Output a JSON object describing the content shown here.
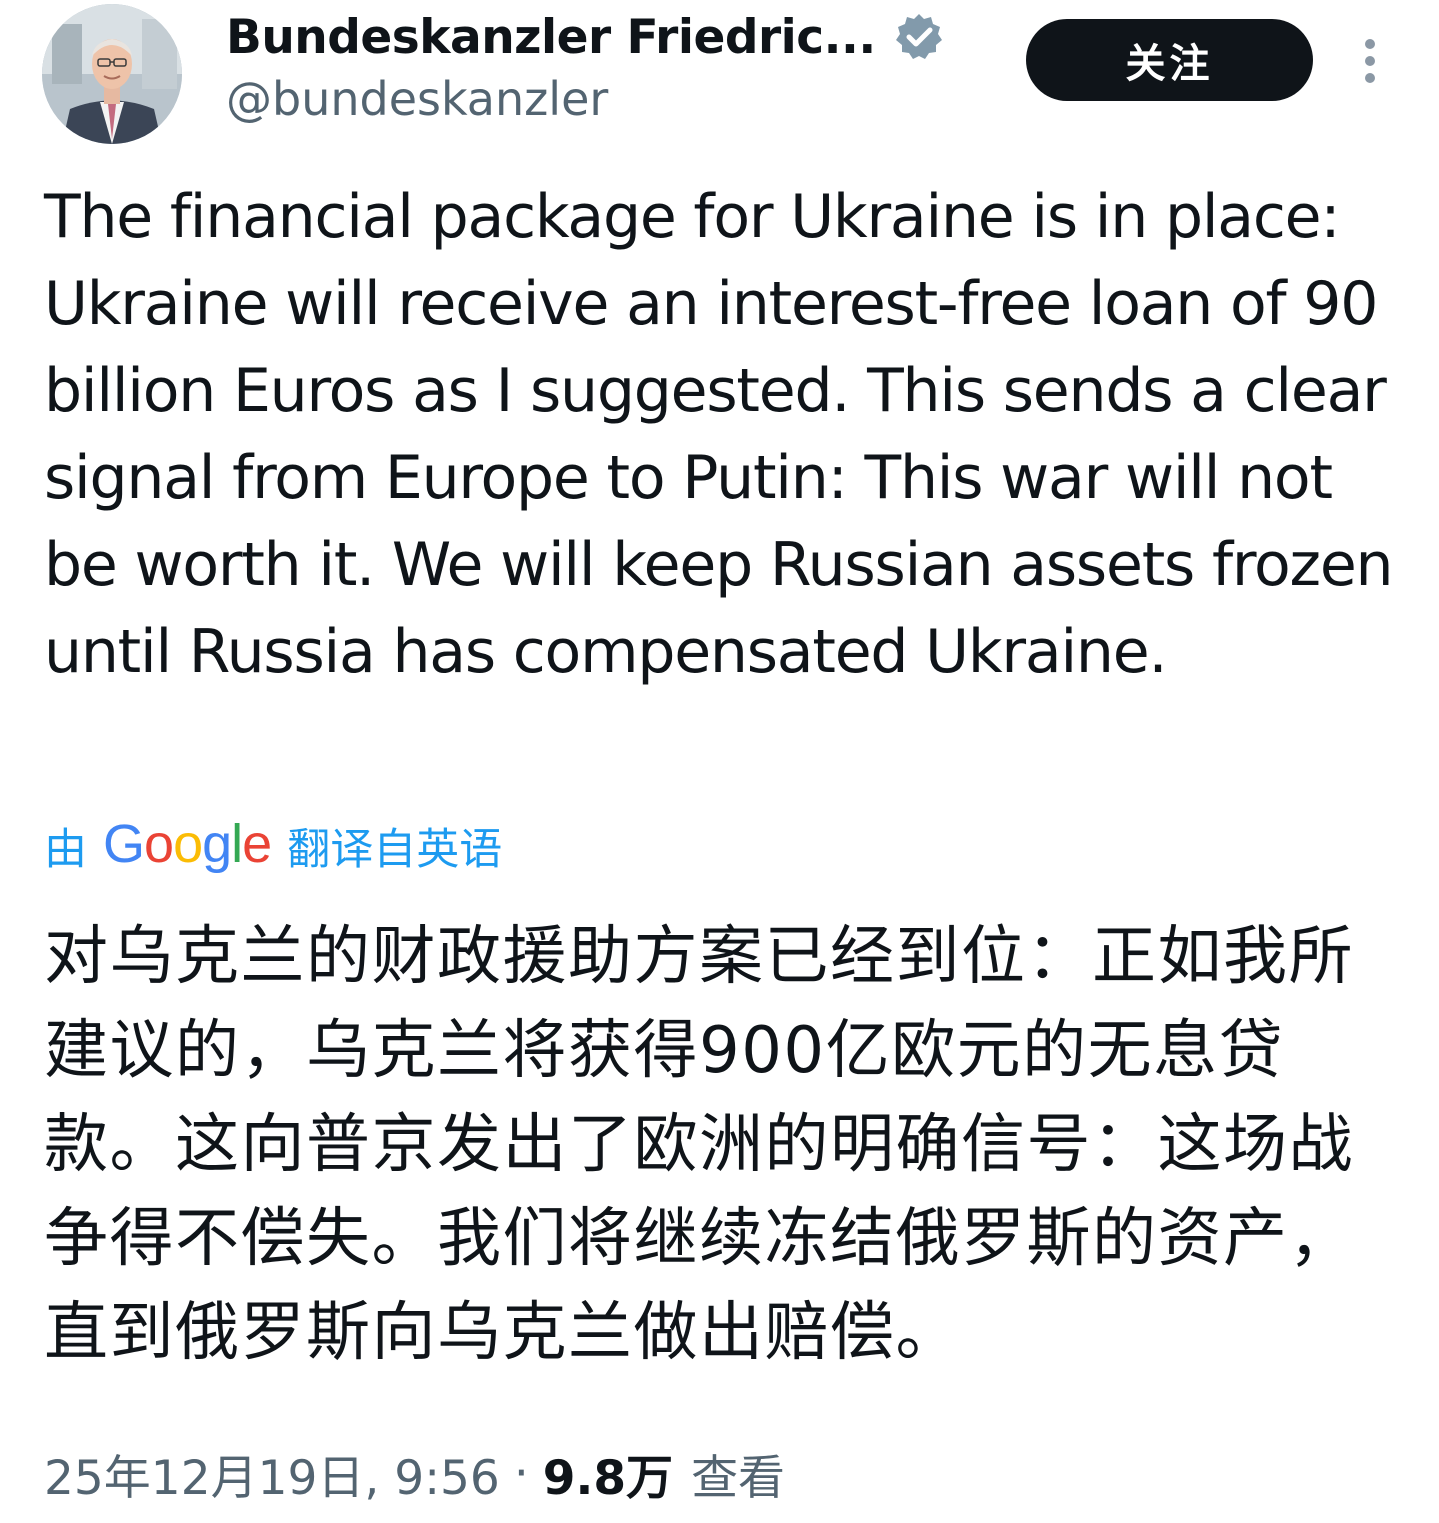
{
  "author": {
    "display_name": "Bundeskanzler Friedric...",
    "handle": "@bundeskanzler",
    "verified_icon": "verified-badge-icon"
  },
  "actions": {
    "follow_label": "关注",
    "more_icon": "more-vertical-icon"
  },
  "tweet": {
    "text": "The financial package for Ukraine is in place: Ukraine will receive an interest-free loan of 90 billion Euros as I suggested. This sends a clear signal from Europe to Putin: This war will not be worth it. We will keep Russian assets frozen until Russia has compensated Ukraine."
  },
  "translation": {
    "prefix": "由",
    "provider": "Google",
    "suffix": "翻译自英语",
    "text": "对乌克兰的财政援助方案已经到位：正如我所建议的，乌克兰将获得900亿欧元的无息贷款。这向普京发出了欧洲的明确信号：这场战争得不偿失。我们将继续冻结俄罗斯的资产，直到俄罗斯向乌克兰做出赔偿。"
  },
  "meta": {
    "timestamp": "25年12月19日, 9:56",
    "separator": "·",
    "views_count": "9.8万",
    "views_label": "查看"
  },
  "colors": {
    "text_primary": "#0f1419",
    "text_secondary": "#536471",
    "link_blue": "#1d9bf0",
    "button_dark": "#0f1419",
    "verified_gray": "#829aab"
  }
}
